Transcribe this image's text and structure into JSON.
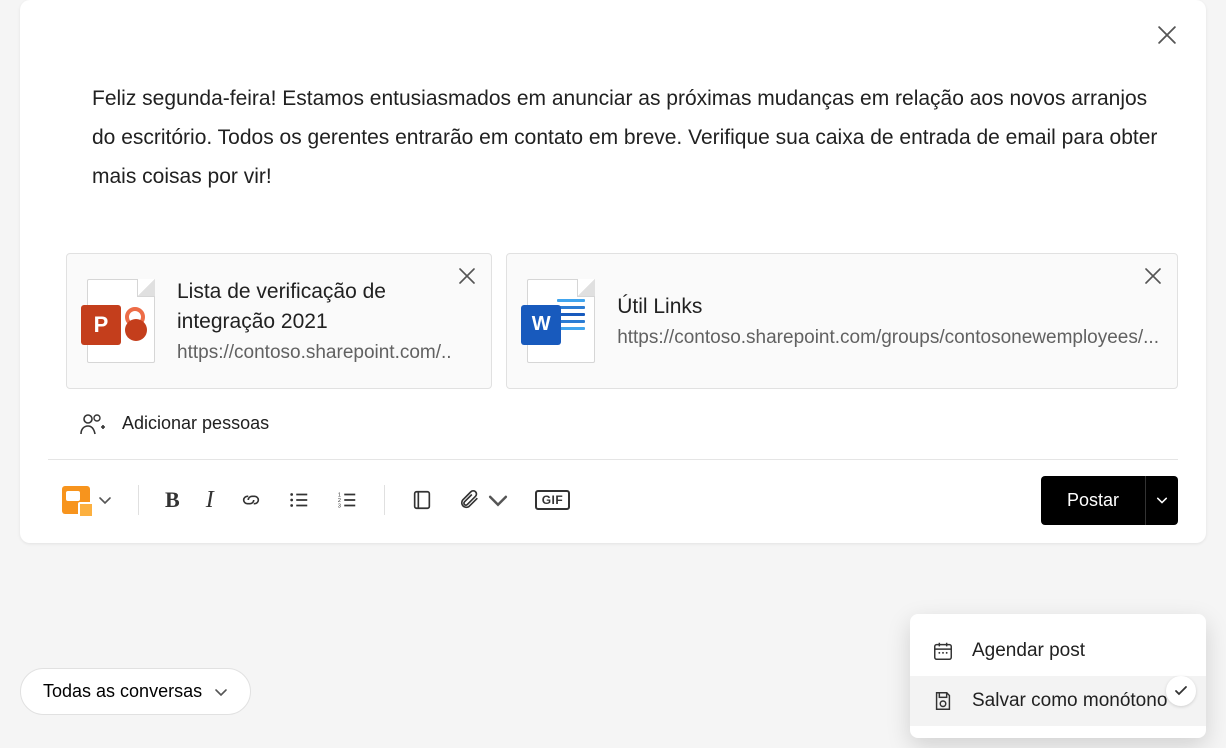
{
  "compose": {
    "text": "Feliz segunda-feira! Estamos entusiasmados em anunciar as próximas mudanças em relação aos novos arranjos do escritório. Todos os gerentes entrarão em contato em breve. Verifique sua caixa de entrada de email para obter mais coisas por vir!"
  },
  "attachments": [
    {
      "type": "powerpoint",
      "badge": "P",
      "title": "Lista de verificação de integração 2021",
      "url": "https://contoso.sharepoint.com/.."
    },
    {
      "type": "word",
      "badge": "W",
      "title": "Útil      Links",
      "url": "https://contoso.sharepoint.com/groups/contosonewemployees/..."
    }
  ],
  "addPeople": {
    "label": "Adicionar pessoas"
  },
  "toolbar": {
    "bold": "B",
    "italic": "I",
    "gif": "GIF"
  },
  "postButton": {
    "label": "Postar"
  },
  "dropdown": {
    "schedule": "Agendar post",
    "saveDraft": "Salvar como monótono"
  },
  "filter": {
    "label": "Todas as conversas"
  }
}
